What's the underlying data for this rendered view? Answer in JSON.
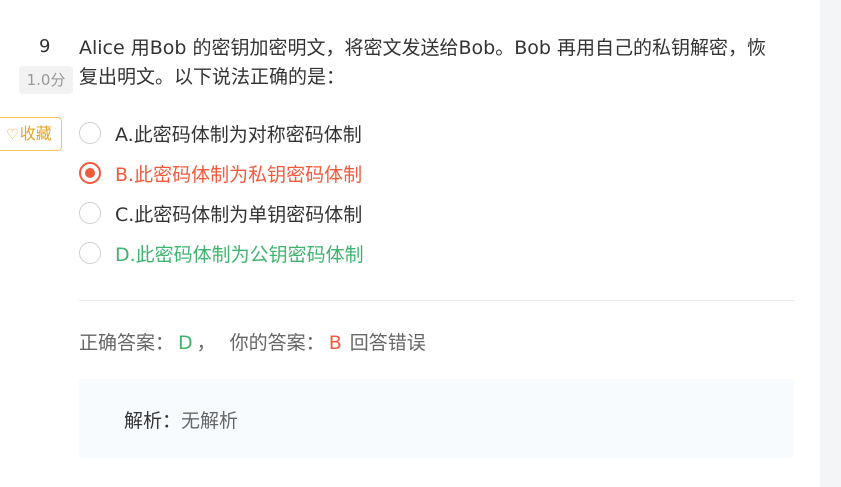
{
  "question": {
    "number": "9",
    "score": "1.0分",
    "text": "Alice 用Bob 的密钥加密明文，将密文发送给Bob。Bob 再用自己的私钥解密，恢复出明文。以下说法正确的是：",
    "favorite_label": "收藏",
    "favorite_icon": "heart-outline-icon"
  },
  "options": [
    {
      "label": "A.此密码体制为对称密码体制",
      "state": "normal"
    },
    {
      "label": "B.此密码体制为私钥密码体制",
      "state": "selected-wrong"
    },
    {
      "label": "C.此密码体制为单钥密码体制",
      "state": "normal"
    },
    {
      "label": "D.此密码体制为公钥密码体制",
      "state": "correct"
    }
  ],
  "result": {
    "correct_prefix": "正确答案：",
    "correct_value": "D",
    "separator": "，",
    "your_prefix": "你的答案：",
    "your_value": "B",
    "status": "回答错误"
  },
  "analysis": {
    "label": "解析：",
    "value": "无解析"
  },
  "colors": {
    "wrong": "#f25a3c",
    "correct": "#3fb46f",
    "favorite": "#e2a52a"
  }
}
